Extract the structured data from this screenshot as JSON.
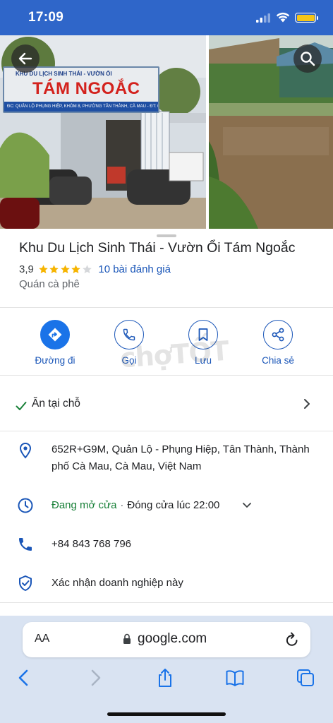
{
  "status_bar": {
    "time": "17:09",
    "battery_color": "#f5c518"
  },
  "header_photos": {
    "sign_subtitle": "KHU DU LỊCH SINH THÁI - VƯỜN ỔI",
    "sign_title": "TÁM NGOẮC",
    "sign_address": "ĐC: QUẢN LỘ PHỤNG HIỆP, KHÓM 8, PHƯỜNG TÂN THÀNH, CÀ MAU - ĐT: 01243 768 796 - 0942 294 929",
    "back_icon": "arrow-left-icon",
    "search_icon": "search-icon"
  },
  "place": {
    "name": "Khu Du Lịch Sinh Thái - Vườn Ổi Tám Ngoắc",
    "rating": "3,9",
    "rating_stars": 3.9,
    "reviews": "10 bài đánh giá",
    "category": "Quán cà phê"
  },
  "actions": [
    {
      "label": "Đường đi",
      "icon": "directions-icon"
    },
    {
      "label": "Gọi",
      "icon": "phone-icon"
    },
    {
      "label": "Lưu",
      "icon": "bookmark-icon"
    },
    {
      "label": "Chia sẻ",
      "icon": "share-icon"
    }
  ],
  "watermark": "chợTỐT",
  "dine_in": {
    "label": "Ăn tại chỗ"
  },
  "info": {
    "address": "652R+G9M, Quản Lộ - Phụng Hiệp, Tân Thành, Thành phố Cà Mau, Cà Mau, Việt Nam",
    "hours_status": "Đang mở cửa",
    "hours_close": "Đóng cửa lúc 22:00",
    "phone": "+84 843 768 796",
    "claim": "Xác nhận doanh nghiệp này"
  },
  "browser": {
    "aa_label": "AA",
    "url": "google.com"
  },
  "colors": {
    "accent": "#1a73e8",
    "link": "#1a56b8",
    "open": "#188038",
    "star": "#f6b400"
  }
}
